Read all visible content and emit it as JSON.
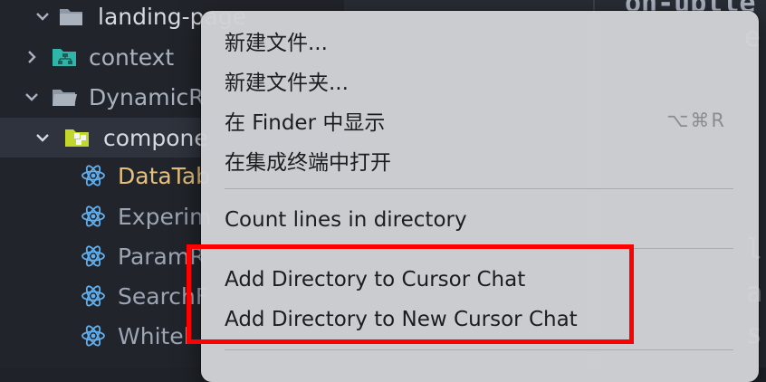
{
  "explorer": {
    "rows": [
      {
        "label": "landing-page",
        "icon": "folder-open-icon",
        "chevron": "down"
      },
      {
        "label": "context",
        "icon": "folder-tree-icon",
        "chevron": "right"
      },
      {
        "label": "DynamicR",
        "icon": "folder-open-icon",
        "chevron": "down"
      },
      {
        "label": "compone",
        "icon": "component-folder-icon",
        "chevron": "down"
      },
      {
        "label": "DataTab",
        "icon": "react-icon"
      },
      {
        "label": "Experim",
        "icon": "react-icon"
      },
      {
        "label": "ParamR",
        "icon": "react-icon"
      },
      {
        "label": "SearchF",
        "icon": "react-icon"
      },
      {
        "label": "Whitel",
        "icon": "react-icon"
      }
    ]
  },
  "editor": {
    "code_fragments": [
      "on-ubtle",
      "e",
      "l",
      "a",
      "s"
    ]
  },
  "context_menu": {
    "items": [
      {
        "label": "新建文件...",
        "shortcut": ""
      },
      {
        "label": "新建文件夹...",
        "shortcut": ""
      },
      {
        "label": "在 Finder 中显示",
        "shortcut": "⌥⌘R"
      },
      {
        "label": "在集成终端中打开",
        "shortcut": ""
      },
      {
        "label": "Count lines in directory",
        "shortcut": ""
      },
      {
        "label": "Add Directory to Cursor Chat",
        "shortcut": ""
      },
      {
        "label": "Add Directory to New Cursor Chat",
        "shortcut": ""
      }
    ]
  },
  "colors": {
    "highlight_border": "#ff0000",
    "menu_background": "#d0d2d6",
    "sidebar_background": "#21252b",
    "react_icon": "#61afef",
    "folder_teal": "#2fb6a8",
    "component_folder": "#c3d62c"
  }
}
